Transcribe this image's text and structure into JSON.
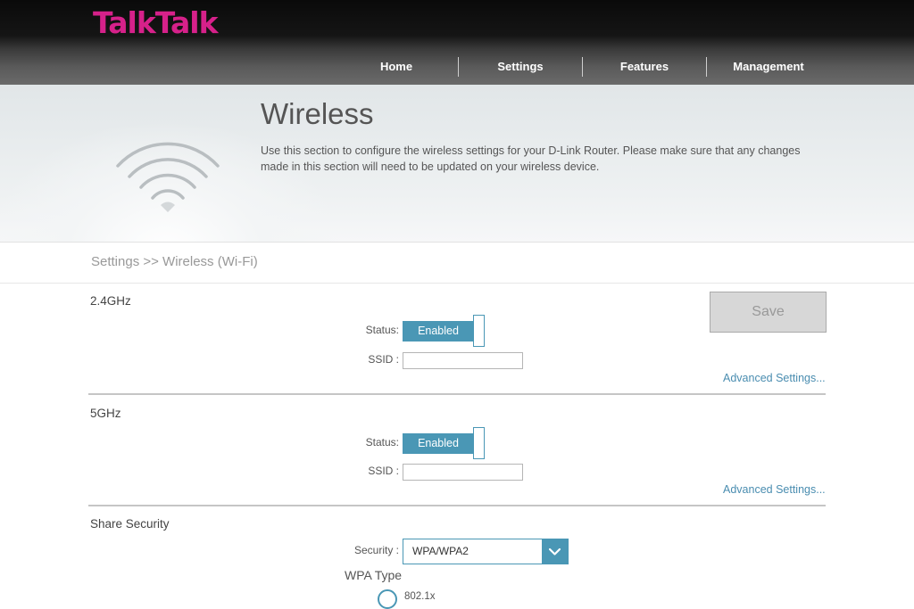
{
  "brand": {
    "logo_text": "TalkTalk",
    "logo_color": "#d6218a"
  },
  "nav": {
    "items": [
      "Home",
      "Settings",
      "Features",
      "Management"
    ]
  },
  "banner": {
    "icon": "wifi-icon",
    "title": "Wireless",
    "description": "Use this section to configure the wireless settings for your D-Link Router. Please make sure that any changes made in this section will need to be updated on your wireless device."
  },
  "breadcrumb": "Settings >> Wireless (Wi-Fi)",
  "save_label": "Save",
  "band24": {
    "heading": "2.4GHz",
    "status_label": "Status:",
    "status_value": "Enabled",
    "ssid_label": "SSID :",
    "ssid_value": "",
    "advanced_link": "Advanced Settings..."
  },
  "band5": {
    "heading": "5GHz",
    "status_label": "Status:",
    "status_value": "Enabled",
    "ssid_label": "SSID :",
    "ssid_value": "",
    "advanced_link": "Advanced Settings..."
  },
  "share_security": {
    "heading": "Share Security",
    "security_label": "Security :",
    "security_value": "WPA/WPA2",
    "wpa_type_heading": "WPA Type",
    "wpa_option": "802.1x"
  },
  "colors": {
    "accent": "#4a97b5",
    "link": "#4a8db0",
    "brand": "#d6218a"
  }
}
